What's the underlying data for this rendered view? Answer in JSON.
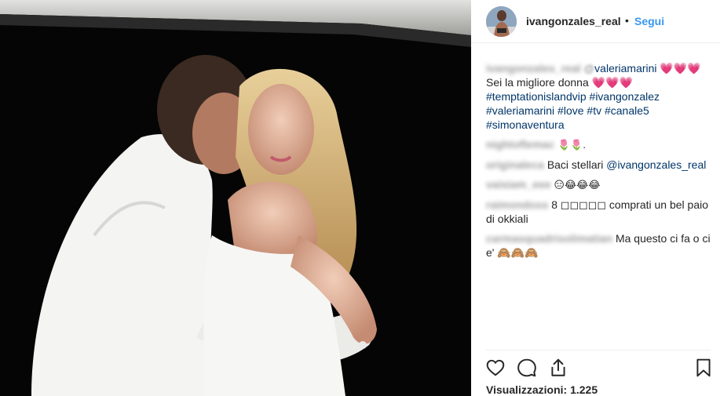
{
  "post": {
    "username": "ivangonzales_real",
    "separator": "•",
    "follow_label": "Segui"
  },
  "caption": {
    "blurred_user": "ivangonzales_real",
    "blurred_mention": "@",
    "mention": "valeriamarini",
    "hearts_1": "💗💗💗",
    "line2": "Sei la migliore donna",
    "hearts_2": "💗💗💗",
    "tags": [
      "#temptationislandvip",
      "#ivangonzalez",
      "#valeriamarini",
      "#love",
      "#tv",
      "#canale5",
      "#simonaventura"
    ]
  },
  "comments": [
    {
      "user": "nightoflemac",
      "text": "🌷🌷.",
      "kind": "tulip"
    },
    {
      "user": "originaleca",
      "text": "Baci stellari ",
      "mention": "@ivangonzales_real"
    },
    {
      "user": "vaisiam_eee",
      "text": "😑😂😂😂",
      "kind": "emoji"
    },
    {
      "user": "raimondoss",
      "text": "8 ◻◻◻◻◻ comprati un bel paio di okkiali"
    },
    {
      "user": "carmasquadrisolimatian",
      "text": "Ma questo ci fa o ci e' 🙈🙈🙈"
    }
  ],
  "actions": {
    "like": "heart-icon",
    "comment": "comment-icon",
    "share": "share-icon",
    "save": "bookmark-icon"
  },
  "views_text": "Visualizzazioni: 1.225",
  "colors": {
    "link": "#003569",
    "follow": "#3897f0",
    "text": "#262626"
  }
}
